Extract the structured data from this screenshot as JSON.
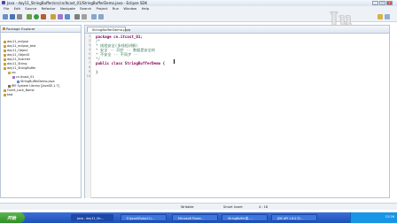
{
  "window": {
    "title": "Java - day11_StringBuffer/src/cn/itcast_01/StringBufferDemo.java - Eclipse SDK",
    "controls": [
      "_",
      "□",
      "×"
    ]
  },
  "menu": [
    "File",
    "Edit",
    "Source",
    "Refactor",
    "Navigate",
    "Search",
    "Project",
    "Run",
    "Window",
    "Help"
  ],
  "watermark": "Ju",
  "package_explorer": {
    "tab_label": "Package Explorer",
    "items": [
      {
        "label": "day11_eclipse",
        "icon": "project-icon"
      },
      {
        "label": "day11_eclipse_test",
        "icon": "project-icon"
      },
      {
        "label": "day11_Object",
        "icon": "project-icon"
      },
      {
        "label": "day11_Object2",
        "icon": "project-icon"
      },
      {
        "label": "day11_Scanner",
        "icon": "project-icon"
      },
      {
        "label": "day11_String",
        "icon": "project-icon"
      },
      {
        "label": "day11_StringBuffer",
        "icon": "project-icon"
      },
      {
        "label": "src",
        "icon": "source-folder-icon"
      },
      {
        "label": "cn.itcast_01",
        "icon": "package-icon"
      },
      {
        "label": "StringBufferDemo.java",
        "icon": "java-file-icon"
      },
      {
        "label": "JRE System Library [JavaSE-1.7]",
        "icon": "library-icon"
      },
      {
        "label": "Overt_Lock_Name",
        "icon": "project-icon"
      },
      {
        "label": "test",
        "icon": "project-icon"
      }
    ]
  },
  "editor": {
    "tab_label": "StringBufferDemo.java",
    "lines": [
      {
        "num": "1",
        "code": "package cn.itcast_01;",
        "kind": "package"
      },
      {
        "num": "2",
        "code": "/*",
        "kind": "comment"
      },
      {
        "num": "3",
        "code": " * 线程安全(多线程讲解)",
        "kind": "comment"
      },
      {
        "num": "4",
        "code": " * 安全 -- 同步 -- 数据是安全的",
        "kind": "comment"
      },
      {
        "num": "5",
        "code": " * 不安全 -- 不同步 --",
        "kind": "comment"
      },
      {
        "num": "6",
        "code": " */",
        "kind": "comment"
      },
      {
        "num": "7",
        "code": "public class StringBufferDemo {",
        "kind": "class"
      },
      {
        "num": "8",
        "code": "",
        "kind": "plain"
      },
      {
        "num": "9",
        "code": "}",
        "kind": "plain"
      },
      {
        "num": "10",
        "code": "",
        "kind": "plain"
      }
    ]
  },
  "status": {
    "writable": "Writable",
    "insert_mode": "Smart Insert",
    "position": "4 : 18"
  },
  "taskbar": {
    "start": "开始",
    "tasks": [
      "Java - day11_Str...",
      "E:\\JavaSE\\day11\\...",
      "Microsoft Power...",
      "StringBuffer类--...",
      "JDK API 1.6.0 中..."
    ],
    "clock": "15:26"
  },
  "colors": {
    "keyword": "#7f0055",
    "comment": "#3f7f5f",
    "taskbar": "#2458c4"
  }
}
